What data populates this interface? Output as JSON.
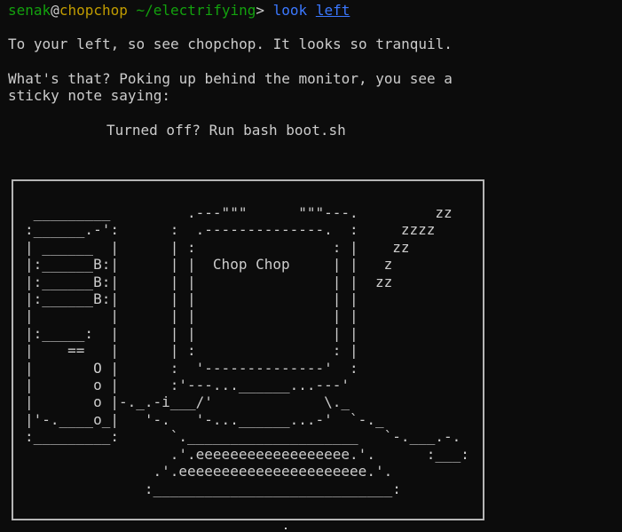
{
  "prompt": {
    "user": "senak",
    "at": "@",
    "host": "chopchop",
    "path": " ~/electrifying",
    "arrow": "> ",
    "command": "look",
    "space": " ",
    "argument": "left"
  },
  "output": {
    "line1": "To your left, so see chopchop. It looks so tranquil.",
    "line2": "What's that? Poking up behind the monitor, you see a",
    "line3": "sticky note saying:",
    "note": "Turned off? Run bash boot.sh"
  },
  "ascii_art": " _________         .---\"\"\"      \"\"\"---.         zz\n:______.-':      :  .--------------.  :     zzzz\n| ______  |      | :                : |    zz\n|:______B:|      | |  Chop Chop     | |   z\n|:______B:|      | |                | |  zz\n|:______B:|      | |                | |\n|         |      | |                | |\n|:_____:  |      | |                | |\n|    ==   |      | :                : |\n|       O |      :  '--------------'  :\n|       o |      :'---...______...---'\n|       o |-._.-i___/'             \\._\n|'-.____o_|   '-.   '-...______...-'  `-._\n:_________:      `.____________________   `-.___.-.\n                 .'.eeeeeeeeeeeeeeeeee.'.      :___:\n               .'.eeeeeeeeeeeeeeeeeeeeee.'.\n              :____________________________:"
}
